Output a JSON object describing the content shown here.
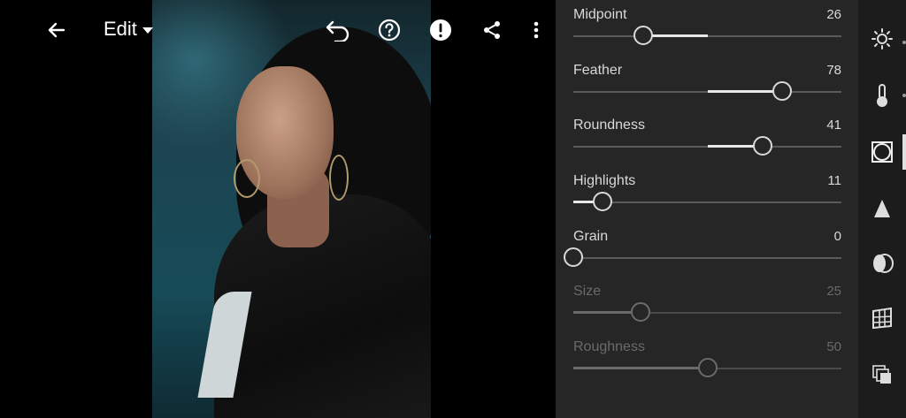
{
  "header": {
    "edit_label": "Edit"
  },
  "panel": {
    "sliders": [
      {
        "label": "Midpoint",
        "value": "26",
        "pos": 0.26,
        "fill_to": 0.5,
        "disabled": false
      },
      {
        "label": "Feather",
        "value": "78",
        "pos": 0.78,
        "fill_to": 0.5,
        "disabled": false
      },
      {
        "label": "Roundness",
        "value": "41",
        "pos": 0.705,
        "fill_to": 0.5,
        "disabled": false
      },
      {
        "label": "Highlights",
        "value": "11",
        "pos": 0.11,
        "fill_to": 0.0,
        "disabled": false
      },
      {
        "label": "Grain",
        "value": "0",
        "pos": 0.0,
        "fill_to": 0.0,
        "disabled": false
      },
      {
        "label": "Size",
        "value": "25",
        "pos": 0.25,
        "fill_to": 0.0,
        "disabled": true
      },
      {
        "label": "Roughness",
        "value": "50",
        "pos": 0.5,
        "fill_to": 0.0,
        "disabled": true
      }
    ]
  },
  "toolstrip": {
    "tools": [
      "sun-icon",
      "thermometer-icon",
      "vignette-icon",
      "sharpen-icon",
      "lens-icon",
      "geometry-icon",
      "layers-icon"
    ],
    "selected": "vignette-icon"
  },
  "colors": {
    "panel_bg": "#262626",
    "text": "#d9d9d9",
    "disabled_text": "#6a6a6a"
  }
}
